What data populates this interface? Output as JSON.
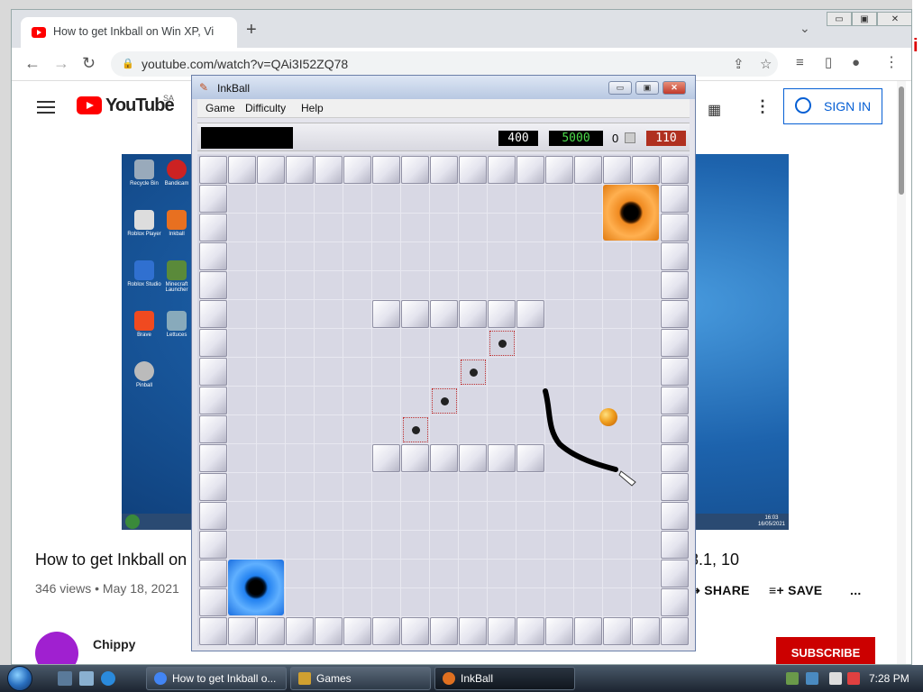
{
  "browser": {
    "tab_title": "How to get Inkball on Win XP, Vi",
    "new_tab": "+",
    "tab_menu": "⌄",
    "url": "youtube.com/watch?v=QAi3I52ZQ78",
    "window_buttons": [
      "▭",
      "▣",
      "✕"
    ]
  },
  "youtube": {
    "logo_text": "YouTube",
    "country": "SA",
    "sign_in": "SIGN IN",
    "video_title": "How to get Inkball on",
    "video_title_tail": "8.1, 10",
    "views_date": "346 views • May 18, 2021",
    "share": "SHARE",
    "save": "SAVE",
    "more": "...",
    "channel": "Chippy",
    "subscribe": "SUBSCRIBE",
    "video_desktop_icons": [
      "Recycle Bin",
      "Bandicam",
      "Roblox Player",
      "Inkball",
      "Roblox Studio",
      "Minecraft Launcher",
      "Brave",
      "Lettuces",
      "Pinball"
    ],
    "video_clock": [
      "16:03",
      "16/05/2021"
    ]
  },
  "inkball": {
    "title": "InkBall",
    "menu": [
      "Game",
      "Difficulty",
      "Help"
    ],
    "scores": {
      "black": "400",
      "green": "5000",
      "zero": "0",
      "red": "110"
    },
    "colors": {
      "orange_hole": "#f08a20",
      "blue_hole": "#2080f0",
      "ball": "#f0a020",
      "ink": "#000000"
    }
  },
  "taskbar": {
    "buttons": [
      "How to get Inkball o...",
      "Games",
      "InkBall"
    ],
    "clock": "7:28 PM"
  }
}
